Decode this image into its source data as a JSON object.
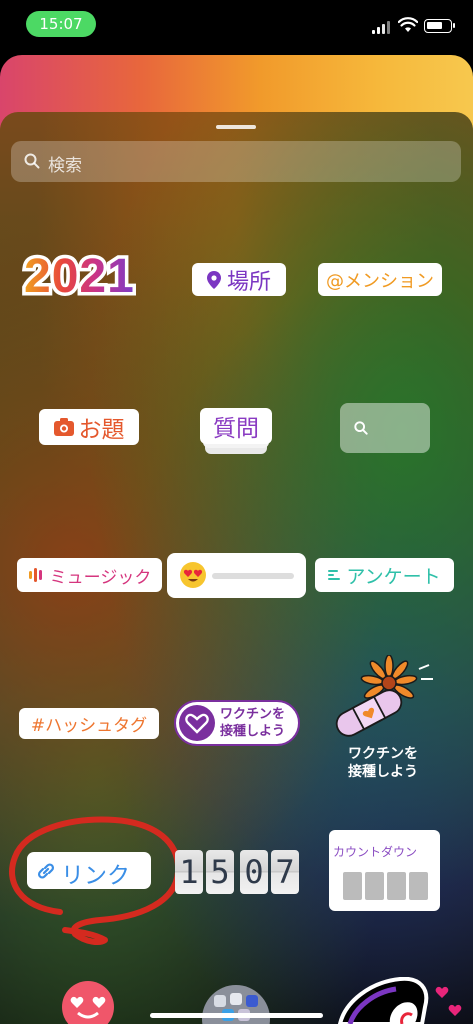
{
  "status_bar": {
    "time": "15:07",
    "time_pill_color": "#4cd964",
    "icons": [
      "signal-icon",
      "wifi-icon",
      "battery-icon"
    ]
  },
  "search": {
    "placeholder": "検索",
    "icon": "search-icon"
  },
  "stickers": {
    "year": "2021",
    "location": "場所",
    "mention": "@メンション",
    "question_topic": "お題",
    "question": "質問",
    "music": "ミュージック",
    "poll": "アンケート",
    "hashtag": "#ハッシュタグ",
    "vaccine_badge": {
      "line1": "ワクチンを",
      "line2": "接種しよう"
    },
    "vaccine_bandaid": {
      "line1": "ワクチンを",
      "line2": "接種しよう"
    },
    "link": "リンク",
    "time_digits": [
      "1",
      "5",
      "0",
      "7"
    ],
    "countdown": "カウントダウン"
  },
  "colors": {
    "location": "#7b36c2",
    "mention": "#f09a22",
    "question_topic": "#e4582d",
    "question": "#8a3bc2",
    "music": "#d5357e",
    "poll": "#2fc0a9",
    "hashtag": "#ee7630",
    "vaccine": "#7a2f9e",
    "link": "#3a8ee6",
    "annotation_circle": "#d42a1f"
  }
}
